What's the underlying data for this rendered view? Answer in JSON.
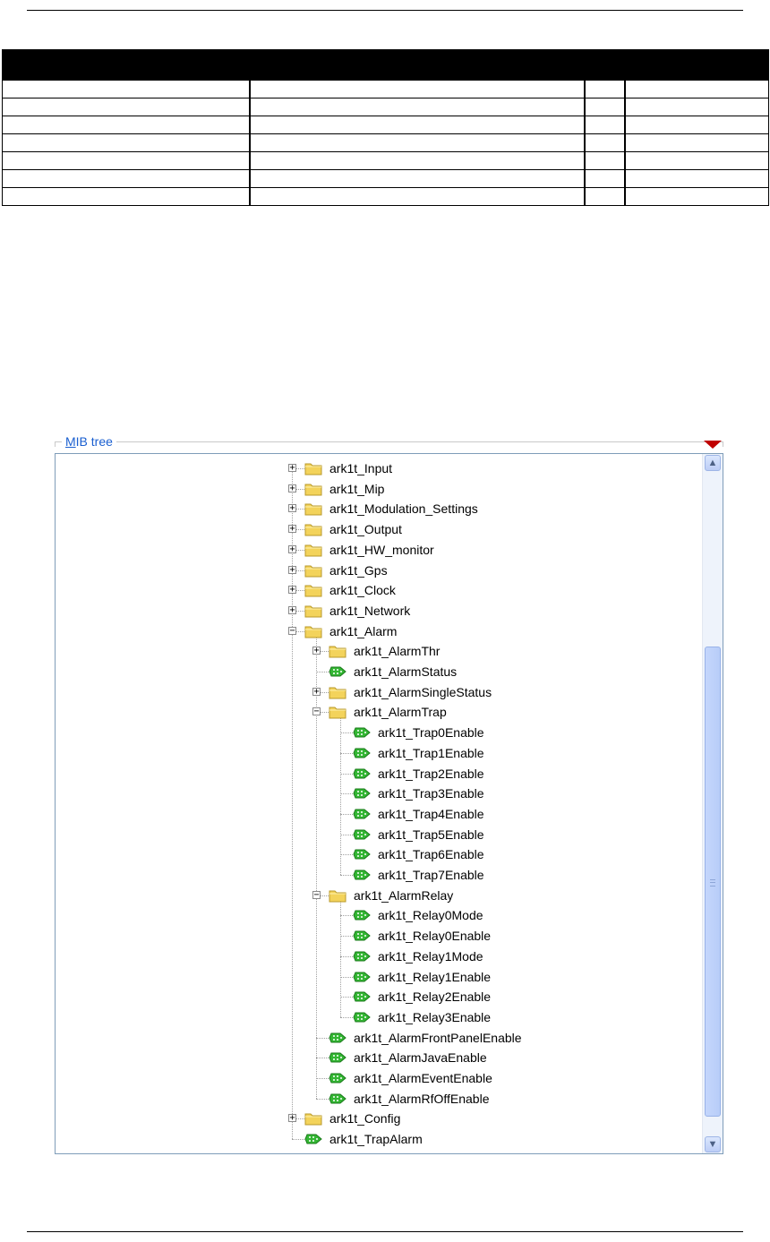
{
  "mib_tree": {
    "title_mnemonic": "M",
    "title_rest": "IB tree",
    "nodes": [
      {
        "label": "ark1t_Input",
        "type": "folder",
        "state": "collapsed",
        "depth": 0
      },
      {
        "label": "ark1t_Mip",
        "type": "folder",
        "state": "collapsed",
        "depth": 0
      },
      {
        "label": "ark1t_Modulation_Settings",
        "type": "folder",
        "state": "collapsed",
        "depth": 0
      },
      {
        "label": "ark1t_Output",
        "type": "folder",
        "state": "collapsed",
        "depth": 0
      },
      {
        "label": "ark1t_HW_monitor",
        "type": "folder",
        "state": "collapsed",
        "depth": 0
      },
      {
        "label": "ark1t_Gps",
        "type": "folder",
        "state": "collapsed",
        "depth": 0
      },
      {
        "label": "ark1t_Clock",
        "type": "folder",
        "state": "collapsed",
        "depth": 0
      },
      {
        "label": "ark1t_Network",
        "type": "folder",
        "state": "collapsed",
        "depth": 0
      },
      {
        "label": "ark1t_Alarm",
        "type": "folder",
        "state": "expanded",
        "depth": 0
      },
      {
        "label": "ark1t_AlarmThr",
        "type": "folder",
        "state": "collapsed",
        "depth": 1
      },
      {
        "label": "ark1t_AlarmStatus",
        "type": "leaf",
        "depth": 1
      },
      {
        "label": "ark1t_AlarmSingleStatus",
        "type": "folder",
        "state": "collapsed",
        "depth": 1
      },
      {
        "label": "ark1t_AlarmTrap",
        "type": "folder",
        "state": "expanded",
        "depth": 1
      },
      {
        "label": "ark1t_Trap0Enable",
        "type": "leaf",
        "depth": 2
      },
      {
        "label": "ark1t_Trap1Enable",
        "type": "leaf",
        "depth": 2
      },
      {
        "label": "ark1t_Trap2Enable",
        "type": "leaf",
        "depth": 2
      },
      {
        "label": "ark1t_Trap3Enable",
        "type": "leaf",
        "depth": 2
      },
      {
        "label": "ark1t_Trap4Enable",
        "type": "leaf",
        "depth": 2
      },
      {
        "label": "ark1t_Trap5Enable",
        "type": "leaf",
        "depth": 2
      },
      {
        "label": "ark1t_Trap6Enable",
        "type": "leaf",
        "depth": 2
      },
      {
        "label": "ark1t_Trap7Enable",
        "type": "leaf",
        "depth": 2
      },
      {
        "label": "ark1t_AlarmRelay",
        "type": "folder",
        "state": "expanded",
        "depth": 1
      },
      {
        "label": "ark1t_Relay0Mode",
        "type": "leaf",
        "depth": 2
      },
      {
        "label": "ark1t_Relay0Enable",
        "type": "leaf",
        "depth": 2
      },
      {
        "label": "ark1t_Relay1Mode",
        "type": "leaf",
        "depth": 2
      },
      {
        "label": "ark1t_Relay1Enable",
        "type": "leaf",
        "depth": 2
      },
      {
        "label": "ark1t_Relay2Enable",
        "type": "leaf",
        "depth": 2
      },
      {
        "label": "ark1t_Relay3Enable",
        "type": "leaf",
        "depth": 2
      },
      {
        "label": "ark1t_AlarmFrontPanelEnable",
        "type": "leaf",
        "depth": 1
      },
      {
        "label": "ark1t_AlarmJavaEnable",
        "type": "leaf",
        "depth": 1
      },
      {
        "label": "ark1t_AlarmEventEnable",
        "type": "leaf",
        "depth": 1
      },
      {
        "label": "ark1t_AlarmRfOffEnable",
        "type": "leaf",
        "depth": 1
      },
      {
        "label": "ark1t_Config",
        "type": "folder",
        "state": "collapsed",
        "depth": 0
      },
      {
        "label": "ark1t_TrapAlarm",
        "type": "leaf",
        "depth": 0
      }
    ]
  },
  "colors": {
    "title": "#1a5fd0",
    "marker": "#c00000",
    "folder": "#f3d35b",
    "leaf": "#33b633"
  },
  "scrollbar": {
    "position": "scrolled-down"
  }
}
